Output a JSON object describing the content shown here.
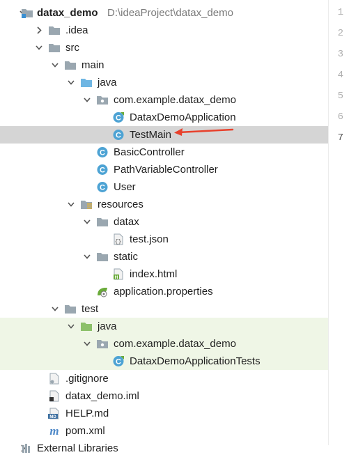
{
  "project": {
    "name": "datax_demo",
    "path": "D:\\ideaProject\\datax_demo"
  },
  "tree": [
    {
      "label": "datax_demo",
      "indent": 0,
      "arrow": "down",
      "icon": "module-folder-icon",
      "bold": true,
      "path": true
    },
    {
      "label": ".idea",
      "indent": 1,
      "arrow": "right",
      "icon": "folder-icon"
    },
    {
      "label": "src",
      "indent": 1,
      "arrow": "down",
      "icon": "folder-icon"
    },
    {
      "label": "main",
      "indent": 2,
      "arrow": "down",
      "icon": "folder-icon"
    },
    {
      "label": "java",
      "indent": 3,
      "arrow": "down",
      "icon": "source-folder-icon"
    },
    {
      "label": "com.example.datax_demo",
      "indent": 4,
      "arrow": "down",
      "icon": "package-icon"
    },
    {
      "label": "DataxDemoApplication",
      "indent": 5,
      "arrow": "none",
      "icon": "spring-class-icon"
    },
    {
      "label": "TestMain",
      "indent": 5,
      "arrow": "none",
      "icon": "class-icon",
      "selected": true
    },
    {
      "label": "BasicController",
      "indent": 4,
      "arrow": "none",
      "icon": "class-icon"
    },
    {
      "label": "PathVariableController",
      "indent": 4,
      "arrow": "none",
      "icon": "class-icon"
    },
    {
      "label": "User",
      "indent": 4,
      "arrow": "none",
      "icon": "class-icon"
    },
    {
      "label": "resources",
      "indent": 3,
      "arrow": "down",
      "icon": "resources-folder-icon"
    },
    {
      "label": "datax",
      "indent": 4,
      "arrow": "down",
      "icon": "folder-icon"
    },
    {
      "label": "test.json",
      "indent": 5,
      "arrow": "none",
      "icon": "json-file-icon"
    },
    {
      "label": "static",
      "indent": 4,
      "arrow": "down",
      "icon": "folder-icon"
    },
    {
      "label": "index.html",
      "indent": 5,
      "arrow": "none",
      "icon": "html-file-icon"
    },
    {
      "label": "application.properties",
      "indent": 4,
      "arrow": "none",
      "icon": "properties-file-icon"
    },
    {
      "label": "test",
      "indent": 2,
      "arrow": "down",
      "icon": "folder-icon"
    },
    {
      "label": "java",
      "indent": 3,
      "arrow": "down",
      "icon": "test-folder-icon",
      "testbg": true
    },
    {
      "label": "com.example.datax_demo",
      "indent": 4,
      "arrow": "down",
      "icon": "package-icon",
      "testbg": true
    },
    {
      "label": "DataxDemoApplicationTests",
      "indent": 5,
      "arrow": "none",
      "icon": "spring-class-icon",
      "testbg": true
    },
    {
      "label": ".gitignore",
      "indent": 1,
      "arrow": "none",
      "icon": "gitignore-file-icon"
    },
    {
      "label": "datax_demo.iml",
      "indent": 1,
      "arrow": "none",
      "icon": "iml-file-icon"
    },
    {
      "label": "HELP.md",
      "indent": 1,
      "arrow": "none",
      "icon": "markdown-file-icon"
    },
    {
      "label": "pom.xml",
      "indent": 1,
      "arrow": "none",
      "icon": "maven-file-icon"
    },
    {
      "label": "External Libraries",
      "indent": 0,
      "arrow": "right",
      "icon": "library-icon"
    }
  ],
  "gutter": {
    "lines": [
      "1",
      "2",
      "3",
      "4",
      "5",
      "6",
      "7"
    ],
    "active": "7"
  },
  "colors": {
    "selection": "#d5d5d5",
    "test_background": "#eff6e6",
    "annotation_arrow": "#e8412c",
    "class_icon": "#4da3d4"
  }
}
